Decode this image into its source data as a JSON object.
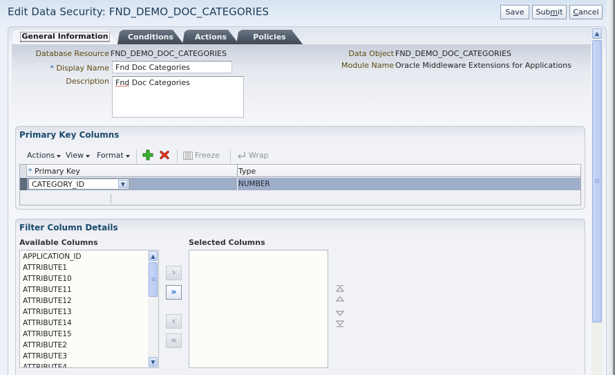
{
  "header": {
    "title": "Edit Data Security: FND_DEMO_DOC_CATEGORIES",
    "buttons": {
      "save": "Save",
      "submit_pre": "Sub",
      "submit_access": "m",
      "submit_post": "it",
      "cancel_access": "C",
      "cancel_post": "ancel"
    }
  },
  "tabs": [
    {
      "label": "General Information",
      "active": true
    },
    {
      "label": "Conditions",
      "active": false
    },
    {
      "label": "Actions",
      "active": false
    },
    {
      "label": "Policies",
      "active": false
    }
  ],
  "general": {
    "database_resource_label": "Database Resource",
    "database_resource_value": "FND_DEMO_DOC_CATEGORIES",
    "display_name_required": "*",
    "display_name_label": "Display Name",
    "display_name_value": "Fnd Doc Categories",
    "description_label": "Description",
    "description_value_misspelled": "Fnd",
    "description_value_rest": " Doc Categories",
    "data_object_label": "Data Object",
    "data_object_value": "FND_DEMO_DOC_CATEGORIES",
    "module_name_label": "Module Name",
    "module_name_value": "Oracle Middleware Extensions for Applications"
  },
  "primary_key": {
    "title": "Primary Key Columns",
    "toolbar": {
      "actions": "Actions",
      "view": "View",
      "format": "Format",
      "add_icon": "add-icon",
      "delete_icon": "delete-icon",
      "freeze": "Freeze",
      "wrap": "Wrap"
    },
    "columns": {
      "required": "*",
      "primary_key": "Primary Key",
      "type": "Type"
    },
    "rows": [
      {
        "primary_key": "CATEGORY_ID",
        "type": "NUMBER",
        "selected": true
      }
    ]
  },
  "filter_columns": {
    "title": "Filter Column Details",
    "available_label": "Available Columns",
    "selected_label": "Selected Columns",
    "available": [
      "APPLICATION_ID",
      "ATTRIBUTE1",
      "ATTRIBUTE10",
      "ATTRIBUTE11",
      "ATTRIBUTE12",
      "ATTRIBUTE13",
      "ATTRIBUTE14",
      "ATTRIBUTE15",
      "ATTRIBUTE2",
      "ATTRIBUTE3",
      "ATTRIBUTE4"
    ],
    "selected": [],
    "shuttle": {
      "move": "›",
      "move_all": "»",
      "remove": "‹",
      "remove_all": "«"
    },
    "reorder": {
      "top": "⩞",
      "up": "△",
      "down": "▽",
      "bottom": "⩡"
    }
  }
}
